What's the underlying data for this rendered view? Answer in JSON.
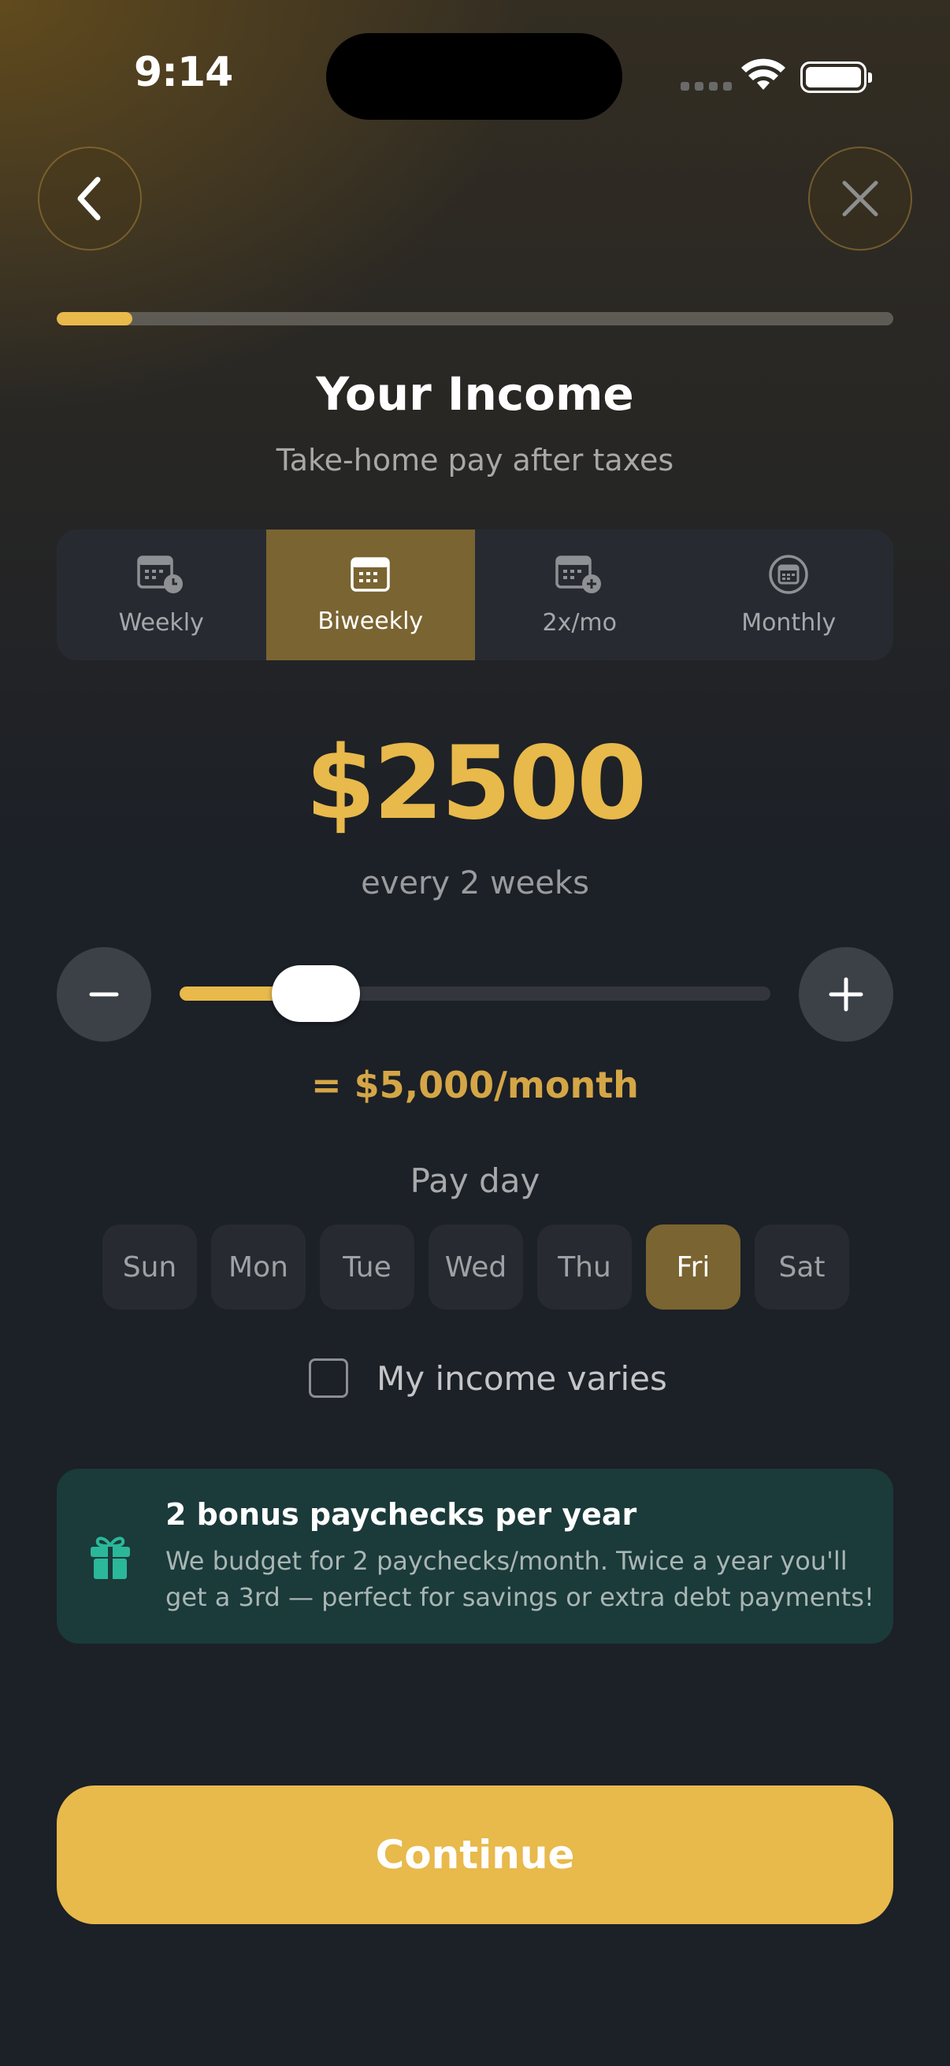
{
  "status_bar": {
    "time": "9:14"
  },
  "progress": {
    "fraction": 0.09
  },
  "header": {
    "title": "Your Income",
    "subtitle": "Take-home pay after taxes"
  },
  "frequency": {
    "options": [
      {
        "label": "Weekly",
        "icon": "calendar-clock-icon"
      },
      {
        "label": "Biweekly",
        "icon": "calendar-icon"
      },
      {
        "label": "2x/mo",
        "icon": "calendar-plus-icon"
      },
      {
        "label": "Monthly",
        "icon": "calendar-circle-icon"
      }
    ],
    "selected": "Biweekly"
  },
  "income": {
    "amount": "$2500",
    "period": "every 2 weeks",
    "slider_fraction": 0.23,
    "monthly_equivalent": "= $5,000/month"
  },
  "payday": {
    "label": "Pay day",
    "days": [
      "Sun",
      "Mon",
      "Tue",
      "Wed",
      "Thu",
      "Fri",
      "Sat"
    ],
    "selected": "Fri"
  },
  "varies": {
    "label": "My income varies",
    "checked": false
  },
  "bonus_card": {
    "icon": "gift-icon",
    "title": "2 bonus paychecks per year",
    "text": "We budget for 2 paychecks/month. Twice a year you'll get a 3rd — perfect for savings or extra debt payments!"
  },
  "cta": {
    "label": "Continue"
  },
  "colors": {
    "accent": "#e8b94b",
    "selected_bg": "#7a6431",
    "background": "#1c2027",
    "bonus_bg": "#1b3a3a",
    "gift": "#2bb79a"
  }
}
